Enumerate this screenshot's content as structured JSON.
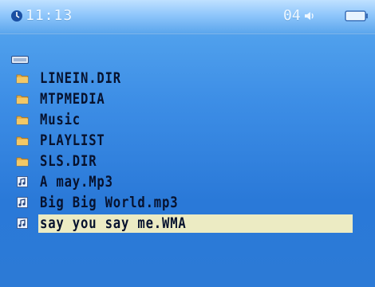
{
  "status_bar": {
    "time": "11:13",
    "volume": "04",
    "icons": [
      "clock-icon",
      "speaker-icon",
      "battery-icon"
    ]
  },
  "location_icon": "device-icon",
  "files": [
    {
      "name": "LINEIN.DIR",
      "type": "folder"
    },
    {
      "name": "MTPMEDIA",
      "type": "folder"
    },
    {
      "name": "Music",
      "type": "folder"
    },
    {
      "name": "PLAYLIST",
      "type": "folder"
    },
    {
      "name": "SLS.DIR",
      "type": "folder"
    },
    {
      "name": "A may.Mp3",
      "type": "audio"
    },
    {
      "name": "Big Big World.mp3",
      "type": "audio"
    },
    {
      "name": "say you say me.WMA",
      "type": "audio",
      "selected": true
    }
  ],
  "colors": {
    "background": "#3d8ee6",
    "status_bar": "#8fc6fb",
    "selection": "#ecebc3",
    "folder": "#e8b04a",
    "text": "#07122e"
  }
}
